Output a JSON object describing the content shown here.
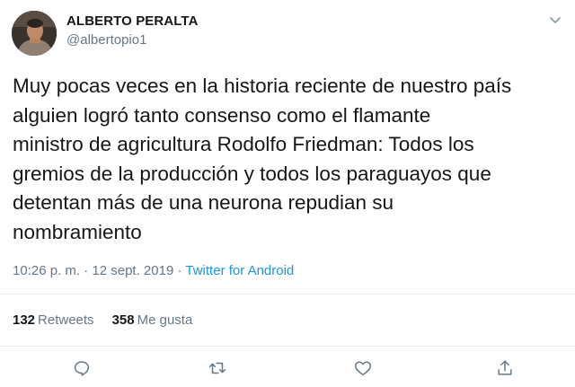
{
  "author": {
    "display_name": "ALBERTO PERALTA",
    "handle": "@albertopio1"
  },
  "tweet": {
    "text": "Muy pocas veces en la historia reciente de nuestro país\nalguien logró tanto consenso como el flamante\nministro de agricultura Rodolfo Friedman: Todos los\ngremios de la producción y todos los paraguayos que\ndetentan más de una neurona repudian su\nnombramiento",
    "time": "10:26 p. m.",
    "separator": "·",
    "date": "12 sept. 2019",
    "source": "Twitter for Android"
  },
  "stats": {
    "retweets_count": "132",
    "retweets_label": "Retweets",
    "likes_count": "358",
    "likes_label": "Me gusta"
  },
  "icons": {
    "menu": "chevron-down-icon",
    "reply": "reply-icon",
    "retweet": "retweet-icon",
    "like": "heart-icon",
    "share": "share-icon"
  },
  "colors": {
    "link": "#1b95e0",
    "secondary_text": "#657786",
    "primary_text": "#14171a",
    "divider": "#e6ecf0"
  }
}
